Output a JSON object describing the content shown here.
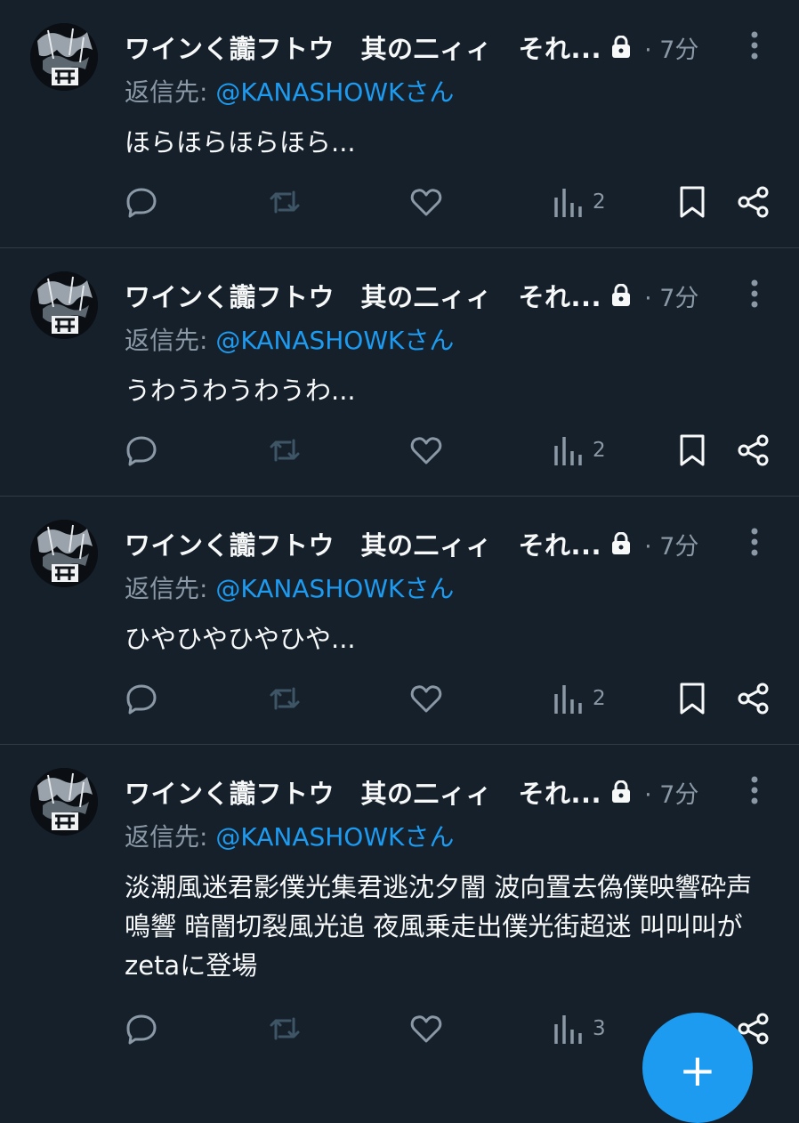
{
  "tweets": [
    {
      "author": "ワインく讟フトウ　其の二ィィ　それ...",
      "time": "· 7分",
      "reply_prefix": "返信先: ",
      "reply_handle": "@KANASHOWKさん",
      "text": "ほらほらほらほら...",
      "views": "2"
    },
    {
      "author": "ワインく讟フトウ　其の二ィィ　それ...",
      "time": "· 7分",
      "reply_prefix": "返信先: ",
      "reply_handle": "@KANASHOWKさん",
      "text": "うわうわうわうわ...",
      "views": "2"
    },
    {
      "author": "ワインく讟フトウ　其の二ィィ　それ...",
      "time": "· 7分",
      "reply_prefix": "返信先: ",
      "reply_handle": "@KANASHOWKさん",
      "text": "ひやひやひやひや...",
      "views": "2"
    },
    {
      "author": "ワインく讟フトウ　其の二ィィ　それ...",
      "time": "· 7分",
      "reply_prefix": "返信先: ",
      "reply_handle": "@KANASHOWKさん",
      "text": "淡潮風迷君影僕光集君逃沈夕闇 波向置去偽僕映響砕声鳴響 暗闇切裂風光追 夜風乗走出僕光街超迷 叫叫叫がzetaに登場",
      "views": "3"
    }
  ],
  "fab": {
    "label": "+"
  },
  "icons": {
    "lock": "lock-icon",
    "more": "more-vertical-icon",
    "reply": "reply-icon",
    "retweet": "retweet-icon",
    "like": "heart-icon",
    "views": "analytics-icon",
    "bookmark": "bookmark-icon",
    "share": "share-icon"
  },
  "colors": {
    "background": "#15202b",
    "text": "#f7f9f9",
    "muted": "#8b98a5",
    "accent": "#1d9bf0",
    "divider": "#2f3b47"
  }
}
